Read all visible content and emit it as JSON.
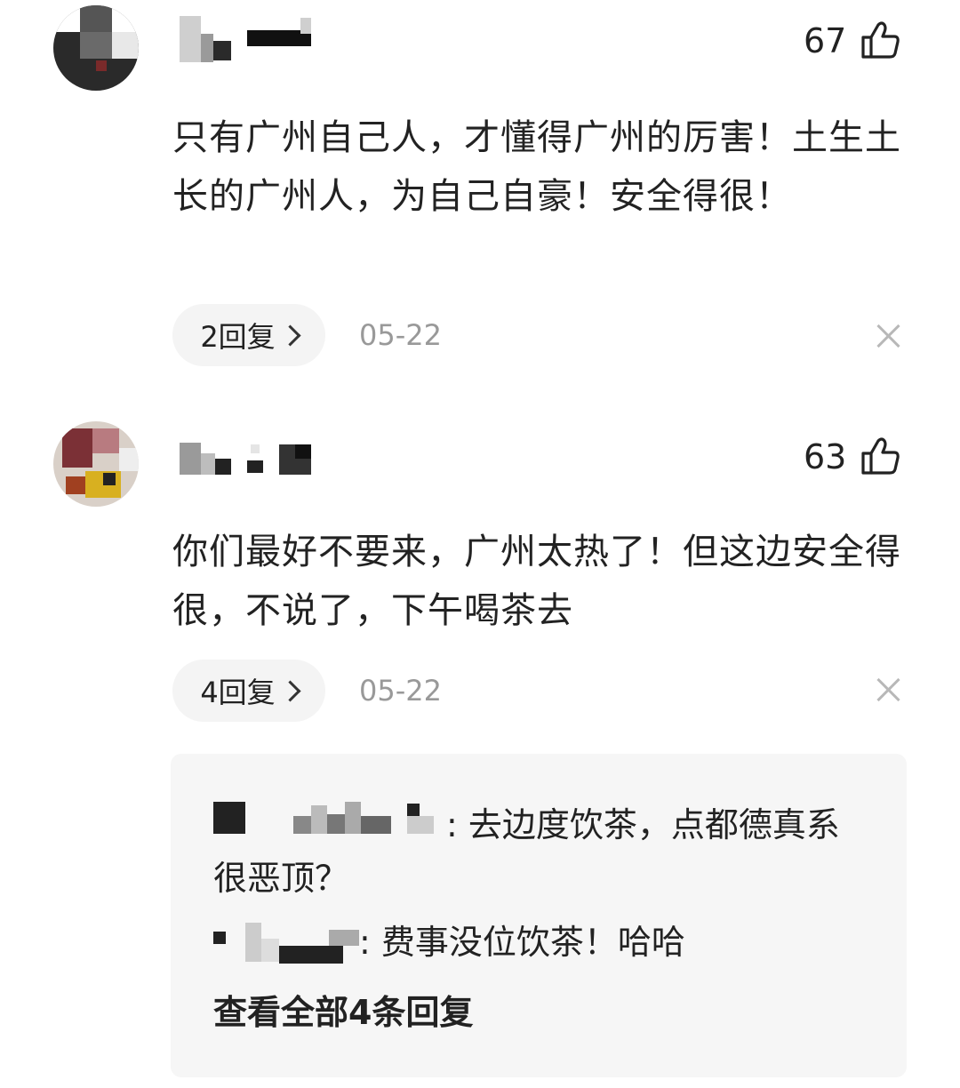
{
  "comments": [
    {
      "likes": "67",
      "text": "只有广州自己人，才懂得广州的厉害！土生土长的广州人，为自己自豪！安全得很！",
      "reply_button": "2回复",
      "date": "05-22"
    },
    {
      "likes": "63",
      "text": "你们最好不要来，广州太热了！但这边安全得很，不说了，下午喝茶去",
      "reply_button": "4回复",
      "date": "05-22"
    }
  ],
  "replies": [
    {
      "text": ": 去边度饮茶，点都德真系很恶顶？"
    },
    {
      "text": ": 费事没位饮茶！哈哈"
    }
  ],
  "view_all_replies": "查看全部4条回复",
  "icons": {
    "like": "thumbs-up-icon",
    "close": "close-icon",
    "chevron": "chevron-right-icon"
  }
}
